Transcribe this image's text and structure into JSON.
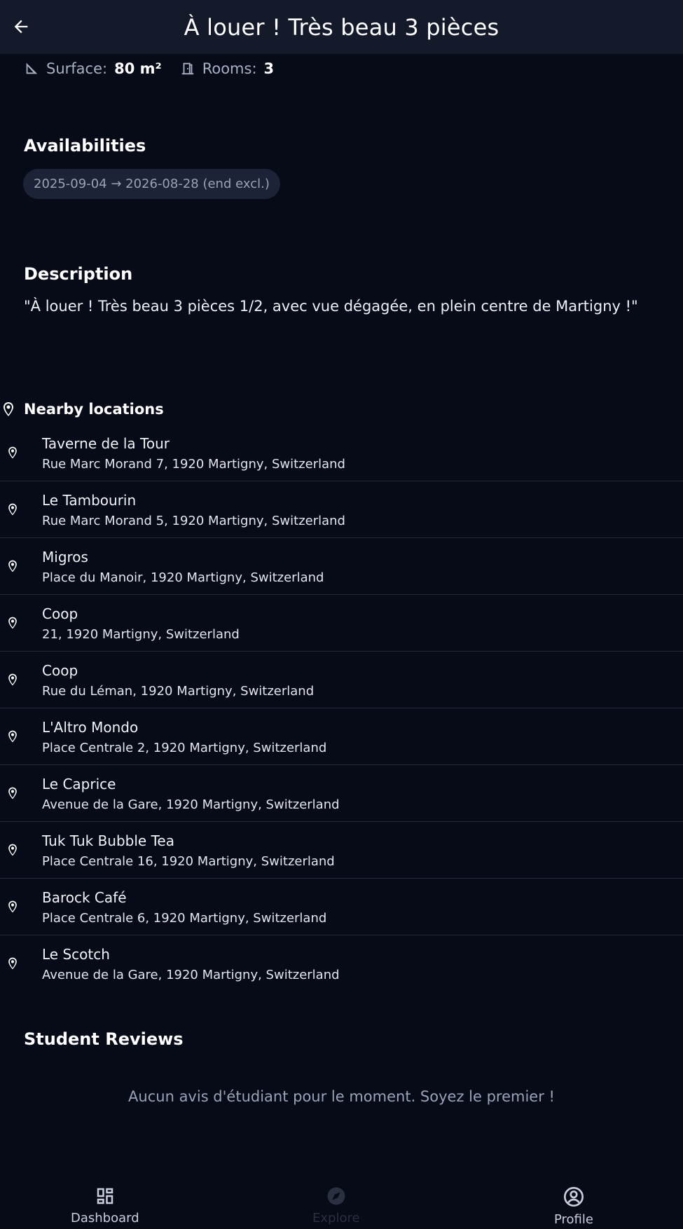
{
  "header": {
    "title": "À louer ! Très beau 3 pièces",
    "back_icon": "arrow-left-icon"
  },
  "specs": {
    "surface_label": "Surface:",
    "surface_value": "80 m²",
    "rooms_label": "Rooms:",
    "rooms_value": "3"
  },
  "availabilities": {
    "title": "Availabilities",
    "ranges": [
      "2025-09-04 → 2026-08-28 (end excl.)"
    ]
  },
  "description": {
    "title": "Description",
    "text": "\"À louer ! Très beau 3 pièces 1/2, avec vue dégagée, en plein centre de Martigny !\""
  },
  "nearby": {
    "title": "Nearby locations",
    "items": [
      {
        "name": "Taverne de la Tour",
        "address": "Rue Marc Morand 7, 1920 Martigny, Switzerland"
      },
      {
        "name": "Le Tambourin",
        "address": "Rue Marc Morand 5, 1920 Martigny, Switzerland"
      },
      {
        "name": "Migros",
        "address": "Place du Manoir, 1920 Martigny, Switzerland"
      },
      {
        "name": "Coop",
        "address": "21, 1920 Martigny, Switzerland"
      },
      {
        "name": "Coop",
        "address": "Rue du Léman, 1920 Martigny, Switzerland"
      },
      {
        "name": "L'Altro Mondo",
        "address": "Place Centrale 2, 1920 Martigny, Switzerland"
      },
      {
        "name": "Le Caprice",
        "address": "Avenue de la Gare, 1920 Martigny, Switzerland"
      },
      {
        "name": "Tuk Tuk Bubble Tea",
        "address": "Place Centrale 16, 1920 Martigny, Switzerland"
      },
      {
        "name": "Barock Café",
        "address": "Place Centrale 6, 1920 Martigny, Switzerland"
      },
      {
        "name": "Le Scotch",
        "address": "Avenue de la Gare, 1920 Martigny, Switzerland"
      }
    ]
  },
  "reviews": {
    "title": "Student Reviews",
    "empty_text": "Aucun avis d'étudiant pour le moment. Soyez le premier !"
  },
  "bottom_nav": {
    "dashboard_label": "Dashboard",
    "explore_label": "Explore",
    "profile_label": "Profile",
    "active": "explore"
  },
  "colors": {
    "background": "#070a17",
    "header": "#151a2b",
    "chip": "#1c2336",
    "muted_text": "#9aa2b8",
    "inactive_nav": "#2a3040"
  }
}
